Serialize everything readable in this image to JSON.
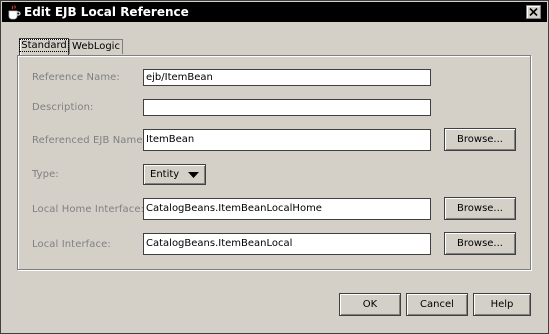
{
  "window": {
    "title": "Edit EJB Local Reference",
    "icon": "java-cup-icon",
    "close_icon": "close-icon"
  },
  "tabs": [
    {
      "label": "Standard",
      "active": true
    },
    {
      "label": "WebLogic",
      "active": false
    }
  ],
  "form": {
    "reference_name": {
      "label": "Reference Name:",
      "value": "ejb/ItemBean"
    },
    "description": {
      "label": "Description:",
      "value": ""
    },
    "referenced_ejb_name": {
      "label": "Referenced EJB Name:",
      "value": "ItemBean",
      "browse_label": "Browse..."
    },
    "type": {
      "label": "Type:",
      "value": "Entity",
      "options": [
        "Entity"
      ]
    },
    "local_home_interface": {
      "label": "Local Home Interface:",
      "value": "CatalogBeans.ItemBeanLocalHome",
      "browse_label": "Browse..."
    },
    "local_interface": {
      "label": "Local Interface:",
      "value": "CatalogBeans.ItemBeanLocal",
      "browse_label": "Browse..."
    }
  },
  "footer": {
    "ok_label": "OK",
    "cancel_label": "Cancel",
    "help_label": "Help"
  }
}
